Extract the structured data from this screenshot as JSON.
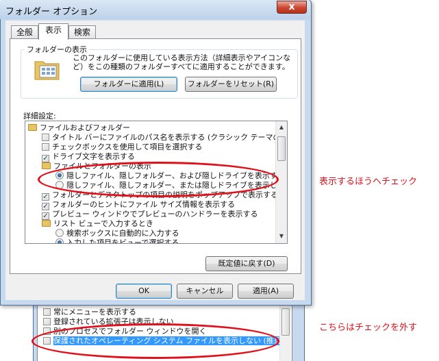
{
  "window": {
    "title": "フォルダー オプション",
    "close_glyph": "x"
  },
  "tabs": [
    {
      "label": "全般",
      "active": false
    },
    {
      "label": "表示",
      "active": true
    },
    {
      "label": "検索",
      "active": false
    }
  ],
  "folder_views": {
    "legend": "フォルダーの表示",
    "description": "このフォルダーに使用している表示方法（詳細表示やアイコンなど）をこの種類のフォルダーすべてに適用することができます。",
    "apply_button": "フォルダーに適用(L)",
    "reset_button": "フォルダーをリセット(R)"
  },
  "advanced": {
    "label": "詳細設定:",
    "items": [
      {
        "kind": "folder",
        "indent": 0,
        "label": "ファイルおよびフォルダー"
      },
      {
        "kind": "checkbox",
        "indent": 1,
        "checked": false,
        "label": "タイトル バーにファイルのパス名を表示する (クラシック テーマのみ)"
      },
      {
        "kind": "checkbox",
        "indent": 1,
        "checked": false,
        "label": "チェックボックスを使用して項目を選択する"
      },
      {
        "kind": "checkbox",
        "indent": 1,
        "checked": true,
        "label": "ドライブ文字を表示する"
      },
      {
        "kind": "folder",
        "indent": 1,
        "label": "ファイルとフォルダーの表示"
      },
      {
        "kind": "radio",
        "indent": 2,
        "checked": true,
        "label": "隠しファイル、隠しフォルダー、および隠しドライブを表示する"
      },
      {
        "kind": "radio",
        "indent": 2,
        "checked": false,
        "label": "隠しファイル、隠しフォルダー、または隠しドライブを表示しない"
      },
      {
        "kind": "checkbox",
        "indent": 1,
        "checked": true,
        "label": "フォルダーとデスクトップの項目の説明をポップアップで表示する"
      },
      {
        "kind": "checkbox",
        "indent": 1,
        "checked": true,
        "label": "フォルダーのヒントにファイル サイズ情報を表示する"
      },
      {
        "kind": "checkbox",
        "indent": 1,
        "checked": true,
        "label": "プレビュー ウィンドウでプレビューのハンドラーを表示する"
      },
      {
        "kind": "folder",
        "indent": 1,
        "label": "リスト ビューで入力するとき"
      },
      {
        "kind": "radio",
        "indent": 2,
        "checked": false,
        "label": "検索ボックスに自動的に入力する"
      },
      {
        "kind": "radio",
        "indent": 2,
        "checked": true,
        "label": "入力した項目をビューで選択する"
      }
    ],
    "restore_button": "既定値に戻す(D)"
  },
  "footer": {
    "ok": "OK",
    "cancel": "キャンセル",
    "apply": "適用(A)"
  },
  "back_dialog": {
    "items": [
      {
        "checked": false,
        "label": "常にメニューを表示する",
        "selected": false
      },
      {
        "checked": false,
        "label": "登録されている拡張子は表示しない",
        "selected": false
      },
      {
        "checked": false,
        "label": "別のプロセスでフォルダー ウィンドウを開く",
        "selected": false
      },
      {
        "checked": false,
        "label": "保護されたオペレーティング システム ファイルを表示しない (推奨)",
        "selected": true
      }
    ]
  },
  "annotations": {
    "note_top": "表示するほうへチェック",
    "note_bottom": "こちらはチェックを外す",
    "color": "#e0111b"
  }
}
